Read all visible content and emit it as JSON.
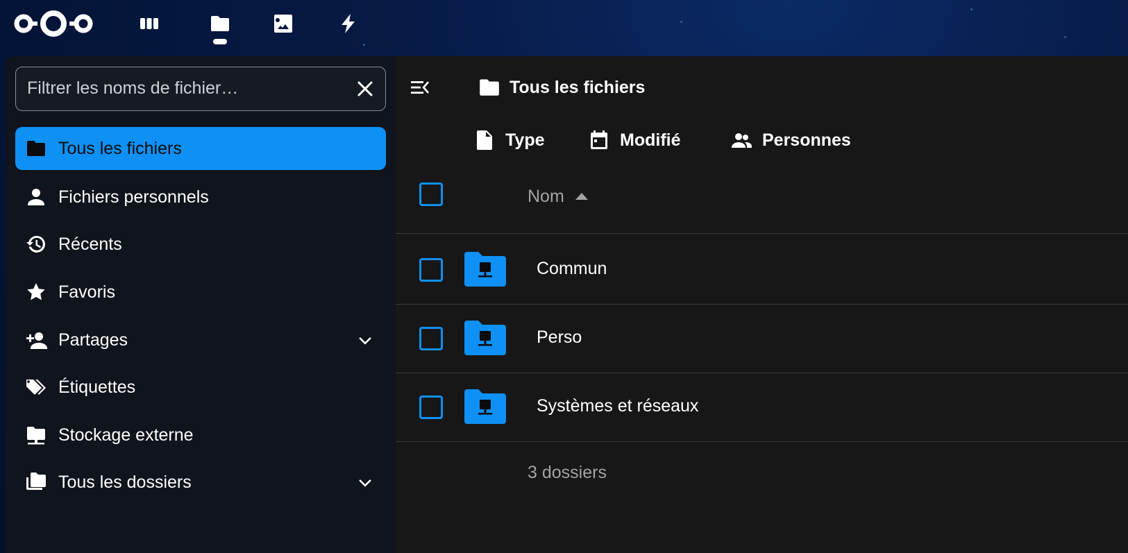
{
  "header": {
    "apps": [
      {
        "name": "dashboard",
        "icon": "dashboard-icon"
      },
      {
        "name": "files",
        "icon": "folder-icon",
        "active": true
      },
      {
        "name": "photos",
        "icon": "image-icon"
      },
      {
        "name": "activity",
        "icon": "lightning-icon"
      }
    ]
  },
  "sidebar": {
    "filter": {
      "placeholder": "Filtrer les noms de fichier…",
      "value": ""
    },
    "items": [
      {
        "label": "Tous les fichiers",
        "icon": "folder-icon",
        "active": true
      },
      {
        "label": "Fichiers personnels",
        "icon": "user-icon"
      },
      {
        "label": "Récents",
        "icon": "history-icon"
      },
      {
        "label": "Favoris",
        "icon": "star-icon"
      },
      {
        "label": "Partages",
        "icon": "share-user-icon",
        "expandable": true
      },
      {
        "label": "Étiquettes",
        "icon": "tags-icon"
      },
      {
        "label": "Stockage externe",
        "icon": "external-storage-icon"
      },
      {
        "label": "Tous les dossiers",
        "icon": "folders-icon",
        "expandable": true
      }
    ]
  },
  "main": {
    "breadcrumb": "Tous les fichiers",
    "filters": [
      {
        "label": "Type",
        "icon": "file-icon"
      },
      {
        "label": "Modifié",
        "icon": "calendar-icon"
      },
      {
        "label": "Personnes",
        "icon": "people-icon"
      }
    ],
    "column_name": "Nom",
    "rows": [
      {
        "name": "Commun",
        "icon": "network-folder-icon"
      },
      {
        "name": "Perso",
        "icon": "network-folder-icon"
      },
      {
        "name": "Systèmes et réseaux",
        "icon": "network-folder-icon"
      }
    ],
    "summary": "3 dossiers"
  },
  "colors": {
    "accent": "#0f90f5",
    "sidebar_bg": "#10141d",
    "main_bg": "#171717",
    "muted_text": "#a3a3a3"
  }
}
